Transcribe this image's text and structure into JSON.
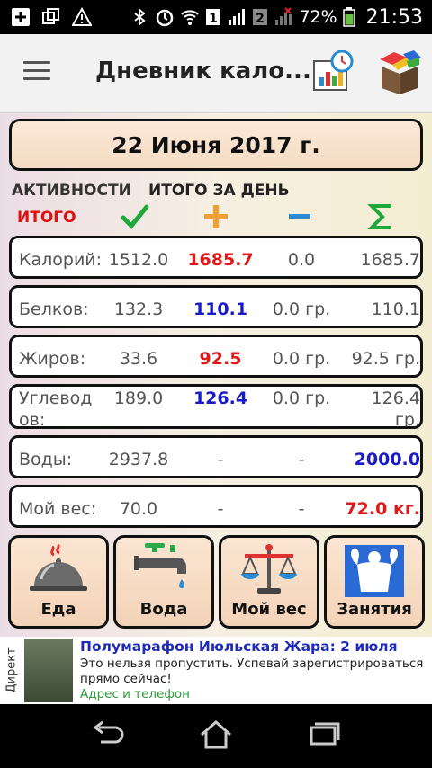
{
  "status_bar": {
    "sim1": "1",
    "sim2": "2",
    "battery_percent": "72%",
    "time": "21:53"
  },
  "app_bar": {
    "title": "Дневник кало..."
  },
  "date": "22 Июня 2017 г.",
  "headers": {
    "activities": "АКТИВНОСТИ",
    "day_total": "ИТОГО ЗА ДЕНЬ",
    "total": "ИТОГО"
  },
  "rows": [
    {
      "label": "Калорий:",
      "consumed": "1512.0",
      "plus": "1685.7",
      "minus": "0.0",
      "sum": "1685.7"
    },
    {
      "label": "Белков:",
      "consumed": "132.3",
      "plus": "110.1",
      "minus": "0.0 гр.",
      "sum": "110.1"
    },
    {
      "label": "Жиров:",
      "consumed": "33.6",
      "plus": "92.5",
      "minus": "0.0 гр.",
      "sum": "92.5 гр."
    },
    {
      "label_line1": "Углевод",
      "label_line2": "ов:",
      "consumed": "189.0",
      "plus": "126.4",
      "minus": "0.0 гр.",
      "sum_line1": "126.4",
      "sum_line2": "гр."
    },
    {
      "label": "Воды:",
      "consumed": "2937.8",
      "plus": "-",
      "minus": "-",
      "sum": "2000.0"
    },
    {
      "label": "Мой вес:",
      "consumed": "70.0",
      "plus": "-",
      "minus": "-",
      "sum": "72.0 кг."
    }
  ],
  "tiles": {
    "food": "Еда",
    "water": "Вода",
    "weight": "Мой вес",
    "workouts": "Занятия"
  },
  "ad": {
    "tag": "Директ",
    "title": "Полумарафон Июльская Жара: 2 июля",
    "body": "Это нельзя пропустить. Успевай зарегистрироваться прямо сейчас!",
    "link": "Адрес и телефон"
  },
  "colors": {
    "red": "#e01818",
    "blue": "#1a1ac8",
    "green_check": "#1fa83a"
  }
}
